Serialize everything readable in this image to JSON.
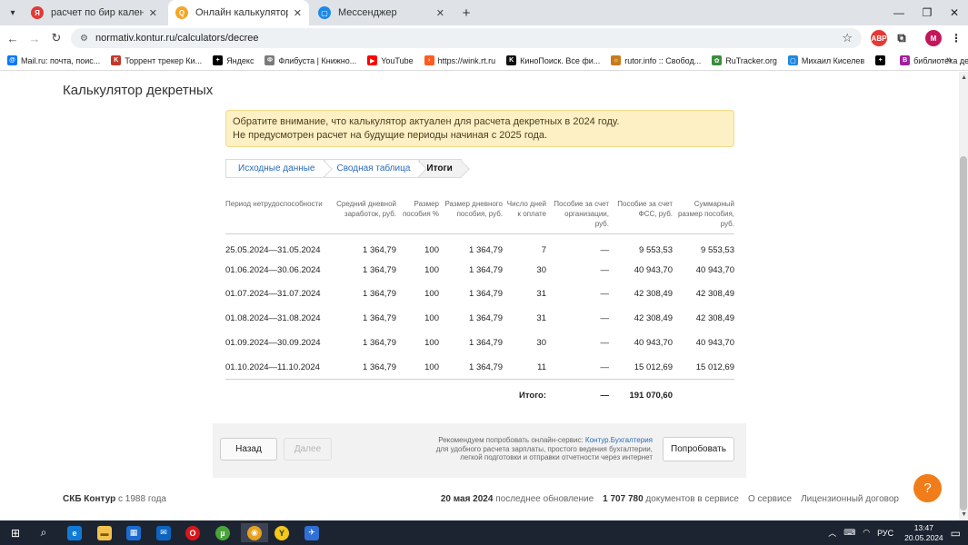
{
  "browser": {
    "tabs": [
      {
        "title": "расчет по бир календарь — Я",
        "favicon_color": "#e53935",
        "favicon_glyph": "Я",
        "active": false
      },
      {
        "title": "Онлайн калькулятор для расч",
        "favicon_color": "#f5a623",
        "favicon_glyph": "Q",
        "active": true
      },
      {
        "title": "Мессенджер",
        "favicon_color": "#1e88e5",
        "favicon_glyph": "▢",
        "active": false
      }
    ],
    "url": "normativ.kontur.ru/calculators/decree",
    "profile_initial": "M",
    "bookmarks": [
      {
        "label": "Mail.ru: почта, поис...",
        "icon_color": "#0077ff",
        "icon": "@"
      },
      {
        "label": "Торрент трекер Ки...",
        "icon_color": "#c0392b",
        "icon": "K"
      },
      {
        "label": "Яндекс",
        "icon_color": "#000",
        "icon": "+"
      },
      {
        "label": "Флибуста | Книжно...",
        "icon_color": "#7a7a7a",
        "icon": "Ф"
      },
      {
        "label": "YouTube",
        "icon_color": "#ff0000",
        "icon": "▶"
      },
      {
        "label": "https://wink.rt.ru",
        "icon_color": "#ff5a1f",
        "icon": "›"
      },
      {
        "label": "КиноПоиск. Все фи...",
        "icon_color": "#111",
        "icon": "K"
      },
      {
        "label": "rutor.info :: Свобод...",
        "icon_color": "#c67c1b",
        "icon": "☼"
      },
      {
        "label": "RuTracker.org",
        "icon_color": "#3a8d3a",
        "icon": "✿"
      },
      {
        "label": "Михаил Киселев",
        "icon_color": "#1e88e5",
        "icon": "▢"
      },
      {
        "label": "",
        "icon_color": "#000",
        "icon": "+"
      },
      {
        "label": "библиотека детско...",
        "icon_color": "#a020a0",
        "icon": "B"
      }
    ]
  },
  "page": {
    "title": "Калькулятор декретных",
    "notice_line1": "Обратите внимание, что калькулятор актуален для расчета декретных в 2024 году.",
    "notice_line2": "Не предусмотрен расчет на будущие периоды начиная с 2025 года.",
    "steps": [
      "Исходные данные",
      "Сводная таблица",
      "Итоги"
    ],
    "table": {
      "headers": [
        "Период нетрудоспособности",
        "Средний дневной заработок, руб.",
        "Размер пособия %",
        "Размер дневного пособия, руб.",
        "Число дней к оплате",
        "Пособие за счет организации, руб.",
        "Пособие за счет ФСС, руб.",
        "Суммарный размер пособия, руб."
      ],
      "rows": [
        [
          "25.05.2024—31.05.2024",
          "1 364,79",
          "100",
          "1 364,79",
          "7",
          "—",
          "9 553,53",
          "9 553,53"
        ],
        [
          "01.06.2024—30.06.2024",
          "1 364,79",
          "100",
          "1 364,79",
          "30",
          "—",
          "40 943,70",
          "40 943,70"
        ],
        [
          "01.07.2024—31.07.2024",
          "1 364,79",
          "100",
          "1 364,79",
          "31",
          "—",
          "42 308,49",
          "42 308,49"
        ],
        [
          "01.08.2024—31.08.2024",
          "1 364,79",
          "100",
          "1 364,79",
          "31",
          "—",
          "42 308,49",
          "42 308,49"
        ],
        [
          "01.09.2024—30.09.2024",
          "1 364,79",
          "100",
          "1 364,79",
          "30",
          "—",
          "40 943,70",
          "40 943,70"
        ],
        [
          "01.10.2024—11.10.2024",
          "1 364,79",
          "100",
          "1 364,79",
          "11",
          "—",
          "15 012,69",
          "15 012,69"
        ]
      ],
      "total_label": "Итого:",
      "total_org": "—",
      "total_fss": "191 070,60"
    },
    "buttons": {
      "back": "Назад",
      "next": "Далее",
      "try": "Попробовать"
    },
    "promo": {
      "prefix": "Рекомендуем попробовать онлайн-сервис: ",
      "link": "Контур.Бухгалтерия",
      "rest": "для удобного расчета зарплаты, простого ведения бухгалтерии, легкой подготовки и отправки отчетности через интернет"
    },
    "footer": {
      "brand": "СКБ Контур",
      "since": " с 1988 года",
      "update_date": "20 мая 2024",
      "update_text": " последнее обновление",
      "doc_count": "1 707 780",
      "doc_text": " документов в сервисе",
      "about": "О сервисе",
      "license": "Лицензионный договор"
    },
    "help": "?"
  },
  "taskbar": {
    "lang": "РУС",
    "time": "13:47",
    "date": "20.05.2024",
    "notif_count": "1"
  }
}
